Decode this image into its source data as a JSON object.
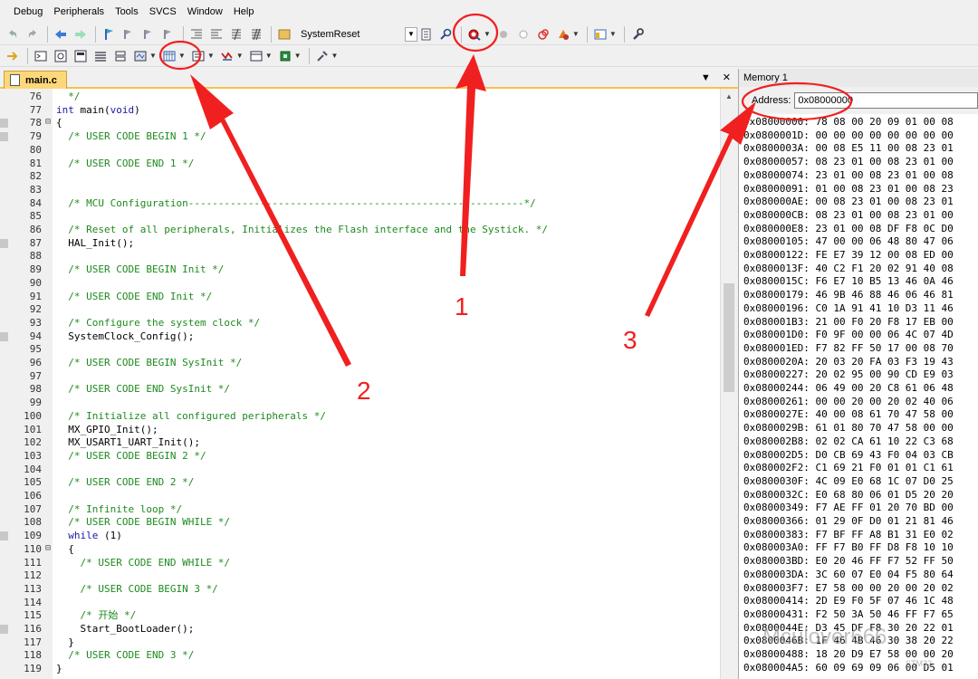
{
  "menu": [
    "Debug",
    "Peripherals",
    "Tools",
    "SVCS",
    "Window",
    "Help"
  ],
  "toolbar": {
    "target_name": "SystemReset"
  },
  "editor": {
    "tab_label": "main.c",
    "dropdown_glyph": "▼",
    "close_glyph": "✕",
    "line_numbers": [
      "76",
      "77",
      "78",
      "79",
      "80",
      "81",
      "82",
      "83",
      "84",
      "85",
      "86",
      "87",
      "88",
      "89",
      "90",
      "91",
      "92",
      "93",
      "94",
      "95",
      "96",
      "97",
      "98",
      "99",
      "100",
      "101",
      "102",
      "103",
      "104",
      "105",
      "106",
      "107",
      "108",
      "109",
      "110",
      "111",
      "112",
      "113",
      "114",
      "115",
      "116",
      "117",
      "118",
      "119"
    ],
    "code_lines": [
      [
        [
          "c",
          "  */"
        ]
      ],
      [
        [
          "k",
          "int"
        ],
        [
          "t",
          " main("
        ],
        [
          "k",
          "void"
        ],
        [
          "t",
          ")"
        ]
      ],
      [
        [
          "t",
          "{"
        ]
      ],
      [
        [
          "c",
          "  /* USER CODE BEGIN 1 */"
        ]
      ],
      [
        [
          "t",
          ""
        ]
      ],
      [
        [
          "c",
          "  /* USER CODE END 1 */"
        ]
      ],
      [
        [
          "t",
          ""
        ]
      ],
      [
        [
          "t",
          ""
        ]
      ],
      [
        [
          "c",
          "  /* MCU Configuration--------------------------------------------------------*/"
        ]
      ],
      [
        [
          "t",
          ""
        ]
      ],
      [
        [
          "c",
          "  /* Reset of all peripherals, Initializes the Flash interface and the Systick. */"
        ]
      ],
      [
        [
          "t",
          "  HAL_Init();"
        ]
      ],
      [
        [
          "t",
          ""
        ]
      ],
      [
        [
          "c",
          "  /* USER CODE BEGIN Init */"
        ]
      ],
      [
        [
          "t",
          ""
        ]
      ],
      [
        [
          "c",
          "  /* USER CODE END Init */"
        ]
      ],
      [
        [
          "t",
          ""
        ]
      ],
      [
        [
          "c",
          "  /* Configure the system clock */"
        ]
      ],
      [
        [
          "t",
          "  SystemClock_Config();"
        ]
      ],
      [
        [
          "t",
          ""
        ]
      ],
      [
        [
          "c",
          "  /* USER CODE BEGIN SysInit */"
        ]
      ],
      [
        [
          "t",
          ""
        ]
      ],
      [
        [
          "c",
          "  /* USER CODE END SysInit */"
        ]
      ],
      [
        [
          "t",
          ""
        ]
      ],
      [
        [
          "c",
          "  /* Initialize all configured peripherals */"
        ]
      ],
      [
        [
          "t",
          "  MX_GPIO_Init();"
        ]
      ],
      [
        [
          "t",
          "  MX_USART1_UART_Init();"
        ]
      ],
      [
        [
          "c",
          "  /* USER CODE BEGIN 2 */"
        ]
      ],
      [
        [
          "t",
          ""
        ]
      ],
      [
        [
          "c",
          "  /* USER CODE END 2 */"
        ]
      ],
      [
        [
          "t",
          ""
        ]
      ],
      [
        [
          "c",
          "  /* Infinite loop */"
        ]
      ],
      [
        [
          "c",
          "  /* USER CODE BEGIN WHILE */"
        ]
      ],
      [
        [
          "k",
          "  while"
        ],
        [
          "t",
          " (1)"
        ]
      ],
      [
        [
          "t",
          "  {"
        ]
      ],
      [
        [
          "c",
          "    /* USER CODE END WHILE */"
        ]
      ],
      [
        [
          "t",
          ""
        ]
      ],
      [
        [
          "c",
          "    /* USER CODE BEGIN 3 */"
        ]
      ],
      [
        [
          "t",
          ""
        ]
      ],
      [
        [
          "c",
          "    /* 开始 */"
        ]
      ],
      [
        [
          "t",
          "    Start_BootLoader();"
        ]
      ],
      [
        [
          "t",
          "  }"
        ]
      ],
      [
        [
          "c",
          "  /* USER CODE END 3 */"
        ]
      ],
      [
        [
          "t",
          "}"
        ]
      ]
    ]
  },
  "memory": {
    "title": "Memory 1",
    "address_label": "Address:",
    "address_value": "0x08000000",
    "rows": [
      "0x08000000: 78 08 00 20 09 01 00 08",
      "0x0800001D: 00 00 00 00 00 00 00 00",
      "0x0800003A: 00 08 E5 11 00 08 23 01",
      "0x08000057: 08 23 01 00 08 23 01 00",
      "0x08000074: 23 01 00 08 23 01 00 08",
      "0x08000091: 01 00 08 23 01 00 08 23",
      "0x080000AE: 00 08 23 01 00 08 23 01",
      "0x080000CB: 08 23 01 00 08 23 01 00",
      "0x080000E8: 23 01 00 08 DF F8 0C D0",
      "0x08000105: 47 00 00 06 48 80 47 06",
      "0x08000122: FE E7 39 12 00 08 ED 00",
      "0x0800013F: 40 C2 F1 20 02 91 40 08",
      "0x0800015C: F6 E7 10 B5 13 46 0A 46",
      "0x08000179: 46 9B 46 88 46 06 46 81",
      "0x08000196: C0 1A 91 41 10 D3 11 46",
      "0x080001B3: 21 00 F0 20 F8 17 EB 00",
      "0x080001D0: F0 9F 00 00 06 4C 07 4D",
      "0x080001ED: F7 82 FF 50 17 00 08 70",
      "0x0800020A: 20 03 20 FA 03 F3 19 43",
      "0x08000227: 20 02 95 00 90 CD E9 03",
      "0x08000244: 06 49 00 20 C8 61 06 48",
      "0x08000261: 00 00 20 00 20 02 40 06",
      "0x0800027E: 40 00 08 61 70 47 58 00",
      "0x0800029B: 61 01 80 70 47 58 00 00",
      "0x080002B8: 02 02 CA 61 10 22 C3 68",
      "0x080002D5: D0 CB 69 43 F0 04 03 CB",
      "0x080002F2: C1 69 21 F0 01 01 C1 61",
      "0x0800030F: 4C 09 E0 68 1C 07 D0 25",
      "0x0800032C: E0 68 80 06 01 D5 20 20",
      "0x08000349: F7 AE FF 01 20 70 BD 00",
      "0x08000366: 01 29 0F D0 01 21 81 46",
      "0x08000383: F7 BF FF A8 B1 31 E0 02",
      "0x080003A0: FF F7 B0 FF D8 F8 10 10",
      "0x080003BD: E0 20 46 FF F7 52 FF 50",
      "0x080003DA: 3C 60 07 E0 04 F5 80 64",
      "0x080003F7: E7 58 00 00 20 00 20 02",
      "0x08000414: 2D E9 F0 5F 07 46 1C 48",
      "0x08000431: F2 50 3A 50 46 FF F7 65",
      "0x0800044E: D3 45 DF F8 30 20 22 01",
      "0x0800046B: 1F 46 4B 46 30 38 20 22",
      "0x08000488: 18 20 D9 E7 58 00 00 20",
      "0x080004A5: 60 09 69 09 06 00 D5 01"
    ]
  },
  "annotations": {
    "numbers": [
      "1",
      "2",
      "3"
    ],
    "color": "#f02020"
  },
  "watermark": "Mculover666",
  "watermark_small": "STM32"
}
